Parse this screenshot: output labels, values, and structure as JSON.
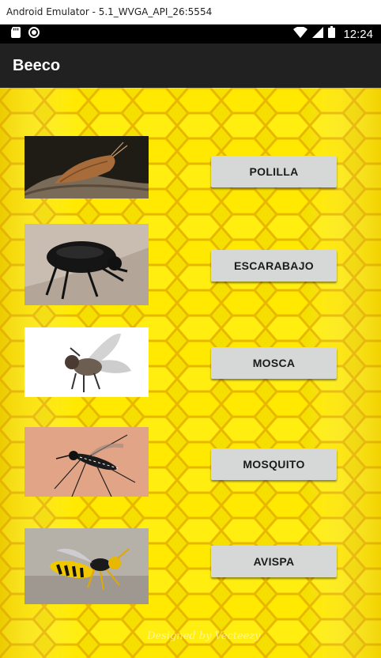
{
  "window": {
    "title": "Android Emulator - 5.1_WVGA_API_26:5554"
  },
  "status_bar": {
    "time": "12:24",
    "icons": [
      "sd-card-icon",
      "circle-icon",
      "wifi-icon",
      "signal-icon",
      "battery-icon"
    ]
  },
  "app_bar": {
    "title": "Beeco"
  },
  "colors": {
    "honey": "#f7e300",
    "app_bar": "#212121",
    "button": "#d6d7d7"
  },
  "insects": [
    {
      "label": "POLILLA",
      "image": "moth-image"
    },
    {
      "label": "ESCARABAJO",
      "image": "beetle-image"
    },
    {
      "label": "MOSCA",
      "image": "fly-image"
    },
    {
      "label": "MOSQUITO",
      "image": "mosquito-image"
    },
    {
      "label": "AVISPA",
      "image": "wasp-image"
    }
  ],
  "watermark": "Designed by Vecteezy"
}
